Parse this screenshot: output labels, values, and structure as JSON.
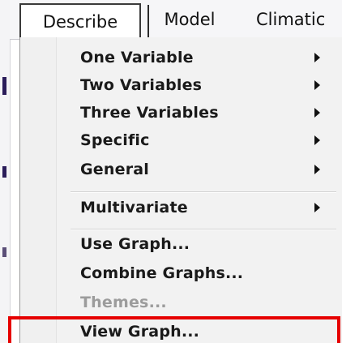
{
  "menubar": {
    "items": [
      {
        "label": "Describe"
      },
      {
        "label": "Model"
      },
      {
        "label": "Climatic"
      }
    ]
  },
  "dropdown": {
    "groups": [
      [
        {
          "label": "One Variable",
          "submenu": true
        },
        {
          "label": "Two Variables",
          "submenu": true
        },
        {
          "label": "Three Variables",
          "submenu": true
        },
        {
          "label": "Specific",
          "submenu": true
        },
        {
          "label": "General",
          "submenu": true
        }
      ],
      [
        {
          "label": "Multivariate",
          "submenu": true
        }
      ],
      [
        {
          "label": "Use Graph...",
          "submenu": false
        },
        {
          "label": "Combine Graphs...",
          "submenu": false
        },
        {
          "label": "Themes...",
          "submenu": false,
          "disabled": true
        },
        {
          "label": "View Graph...",
          "submenu": false,
          "highlighted": true
        }
      ]
    ]
  },
  "colors": {
    "highlight_border": "#e60000",
    "disabled_text": "#9c9c9c",
    "menu_background": "#f2f2f2"
  }
}
